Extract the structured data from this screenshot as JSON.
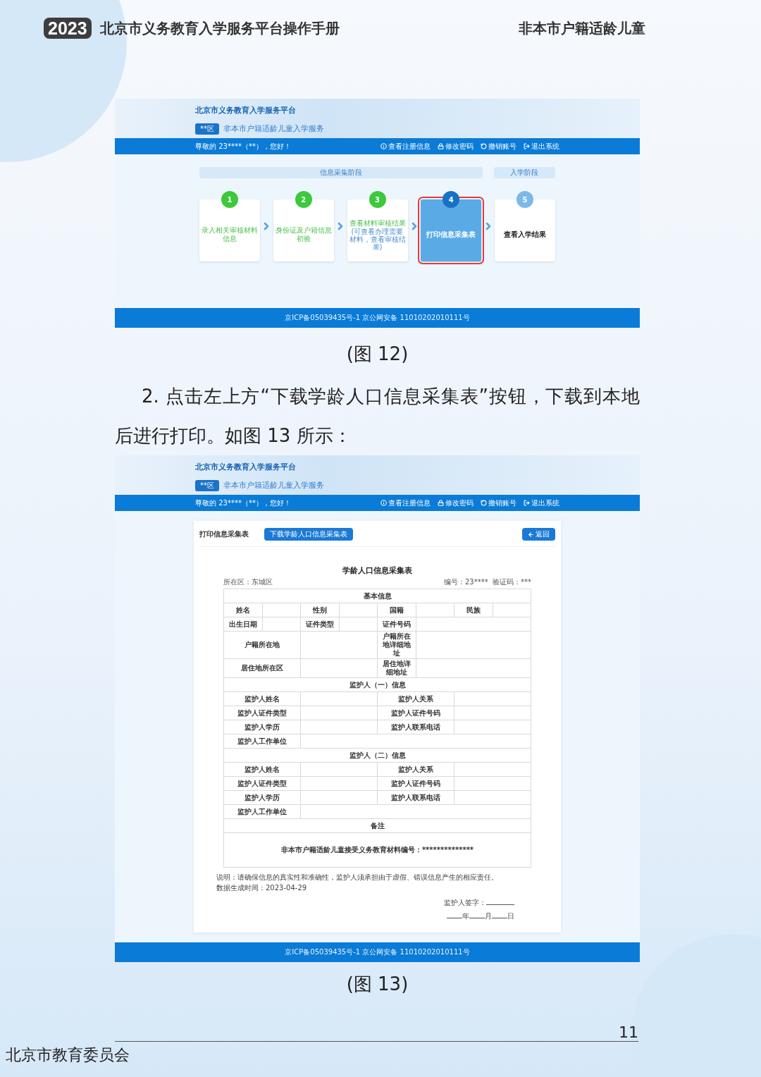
{
  "header": {
    "year": "2023",
    "title": "北京市义务教育入学服务平台操作手册",
    "section": "非本市户籍适龄儿童"
  },
  "figure_12": {
    "platform_title": "北京市义务教育入学服务平台",
    "district": "**区",
    "service": "非本市户籍适龄儿童入学服务",
    "greeting": "尊敬的 23****（**），您好！",
    "nav": [
      {
        "label": "查看注册信息"
      },
      {
        "label": "修改密码"
      },
      {
        "label": "撤销账号"
      },
      {
        "label": "退出系统"
      }
    ],
    "stages": [
      {
        "label": "信息采集阶段"
      },
      {
        "label": "入学阶段"
      }
    ],
    "steps": [
      {
        "number": "1",
        "label": "录入相关审核材料信息",
        "completed": true,
        "current": false,
        "highlighted": false
      },
      {
        "number": "2",
        "label": "身份证及户籍信息初验",
        "completed": true,
        "current": false,
        "highlighted": false
      },
      {
        "number": "3",
        "label": "查看材料审核结果",
        "note": "(可查看办理需要材料，查看审核结果)",
        "completed": true,
        "current": false,
        "highlighted": false
      },
      {
        "number": "4",
        "label": "打印信息采集表",
        "completed": false,
        "current": true,
        "highlighted": true
      },
      {
        "number": "5",
        "label": "查看入学结果",
        "completed": false,
        "current": false,
        "highlighted": false
      }
    ],
    "footer": "京ICP备05039435号-1 京公网安备 11010202010111号"
  },
  "caption_12": "(图 12)",
  "instruction": "2. 点击左上方“下载学龄人口信息采集表”按钮，下载到本地后进行打印。如图 13 所示：",
  "figure_13": {
    "platform_title": "北京市义务教育入学服务平台",
    "district": "**区",
    "service": "非本市户籍适龄儿童入学服务",
    "greeting": "尊敬的 23****（**），您好！",
    "nav": [
      {
        "label": "查看注册信息"
      },
      {
        "label": "修改密码"
      },
      {
        "label": "撤销账号"
      },
      {
        "label": "退出系统"
      }
    ],
    "card": {
      "title": "打印信息采集表",
      "download_button": "下载学龄人口信息采集表",
      "back_button": "返回"
    },
    "form": {
      "title": "学龄人口信息采集表",
      "district": "所在区：东城区",
      "serial": "编号：23****  验证码：***",
      "rows": [
        {
          "kind": "section",
          "labels": [
            "基本信息"
          ]
        },
        {
          "kind": "four_pairs",
          "labels": [
            "姓名",
            "性别",
            "国籍",
            "民族"
          ]
        },
        {
          "kind": "three_pairs",
          "labels": [
            "出生日期",
            "证件类型",
            "证件号码"
          ]
        },
        {
          "kind": "address",
          "labels": [
            "户籍所在地",
            "户籍所在地详细地址"
          ]
        },
        {
          "kind": "address",
          "labels": [
            "居住地所在区",
            "居住地详细地址"
          ]
        },
        {
          "kind": "section",
          "labels": [
            "监护人（一）信息"
          ]
        },
        {
          "kind": "two_pairs",
          "labels": [
            "监护人姓名",
            "监护人关系"
          ]
        },
        {
          "kind": "two_pairs",
          "labels": [
            "监护人证件类型",
            "监护人证件号码"
          ]
        },
        {
          "kind": "two_pairs",
          "labels": [
            "监护人学历",
            "监护人联系电话"
          ]
        },
        {
          "kind": "single",
          "labels": [
            "监护人工作单位"
          ]
        },
        {
          "kind": "section",
          "labels": [
            "监护人（二）信息"
          ]
        },
        {
          "kind": "two_pairs",
          "labels": [
            "监护人姓名",
            "监护人关系"
          ]
        },
        {
          "kind": "two_pairs",
          "labels": [
            "监护人证件类型",
            "监护人证件号码"
          ]
        },
        {
          "kind": "two_pairs",
          "labels": [
            "监护人学历",
            "监护人联系电话"
          ]
        },
        {
          "kind": "single",
          "labels": [
            "监护人工作单位"
          ]
        },
        {
          "kind": "section",
          "labels": [
            "备注"
          ]
        },
        {
          "kind": "note",
          "labels": [
            "非本市户籍适龄儿童接受义务教育材料编号：**************"
          ]
        }
      ],
      "explanation": "说明：请确保信息的真实性和准确性，监护人须承担由于虚假、错误信息产生的相应责任。",
      "generated": "数据生成时间：2023-04-29",
      "signature": "监护人签字：",
      "date": [
        "年",
        "月",
        "日"
      ]
    },
    "footer": "京ICP备05039435号-1 京公网安备 11010202010111号"
  },
  "caption_13": "(图 13)",
  "page_number": "11",
  "publisher": "北京市教育委员会"
}
